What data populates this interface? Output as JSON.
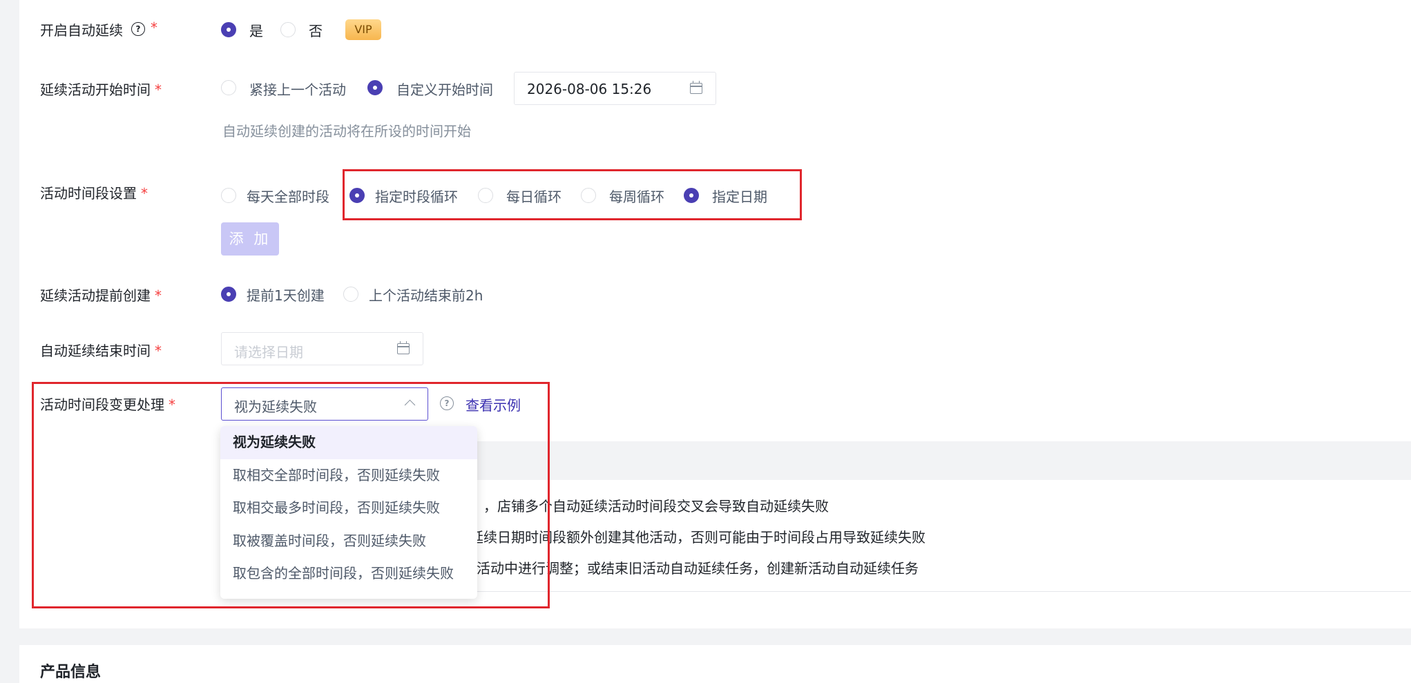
{
  "form": {
    "auto_extend": {
      "label": "开启自动延续",
      "required_mark": "*",
      "options": [
        "是",
        "否"
      ],
      "selected": "是",
      "badge": "VIP"
    },
    "start_time": {
      "label": "延续活动开始时间",
      "required_mark": "*",
      "options": [
        "紧接上一个活动",
        "自定义开始时间"
      ],
      "selected": "自定义开始时间",
      "value": "2026-08-06 15:26",
      "hint": "自动延续创建的活动将在所设的时间开始"
    },
    "period": {
      "label": "活动时间段设置",
      "required_mark": "*",
      "options": [
        "每天全部时段",
        "指定时段循环",
        "每日循环",
        "每周循环",
        "指定日期"
      ],
      "selected": [
        "指定时段循环",
        "指定日期"
      ],
      "add_button": "添 加"
    },
    "advance_create": {
      "label": "延续活动提前创建",
      "required_mark": "*",
      "options": [
        "提前1天创建",
        "上个活动结束前2h"
      ],
      "selected": "提前1天创建"
    },
    "end_time": {
      "label": "自动延续结束时间",
      "required_mark": "*",
      "placeholder": "请选择日期"
    },
    "change_handling": {
      "label": "活动时间段变更处理",
      "required_mark": "*",
      "value": "视为延续失败",
      "example_link": "查看示例",
      "dropdown_options": [
        "视为延续失败",
        "取相交全部时间段，否则延续失败",
        "取相交最多时间段，否则延续失败",
        "取被覆盖时间段，否则延续失败",
        "取包含的全部时间段，否则延续失败"
      ],
      "dropdown_selected": "视为延续失败"
    }
  },
  "notes": [
    "，店铺多个自动延续活动时间段交叉会导致自动延续失败",
    "延续日期时间段额外创建其他活动，否则可能由于时间段占用导致延续失败",
    "的活动中进行调整；或结束旧活动自动延续任务，创建新活动自动延续任务"
  ],
  "product_section": {
    "title": "产品信息"
  },
  "colors": {
    "primary": "#4a3fb3",
    "required": "#f53f3f",
    "highlight_box": "#e0262d",
    "disabled_button": "#c9c7f6"
  }
}
